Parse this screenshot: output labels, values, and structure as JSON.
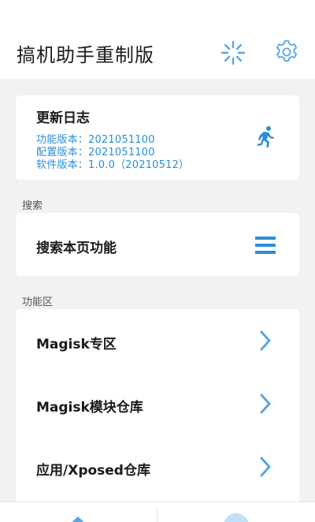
{
  "header": {
    "title": "搞机助手重制版",
    "loader_icon": "loading-spinner-icon",
    "settings_icon": "gear-icon"
  },
  "changelog": {
    "title": "更新日志",
    "feature_version": "功能版本：2021051100",
    "config_version": "配置版本：2021051100",
    "software_version": "软件版本：1.0.0（20210512）",
    "icon": "running-person-icon"
  },
  "search": {
    "section_label": "搜索",
    "label": "搜索本页功能",
    "icon": "menu-icon"
  },
  "functions": {
    "section_label": "功能区",
    "items": [
      {
        "label": "Magisk专区"
      },
      {
        "label": "Magisk模块仓库"
      },
      {
        "label": "应用/Xposed仓库"
      }
    ]
  },
  "colors": {
    "accent": "#2a8fd6",
    "icon_blue": "#5aa6e0",
    "background": "#f2f2f2",
    "card": "#ffffff"
  }
}
